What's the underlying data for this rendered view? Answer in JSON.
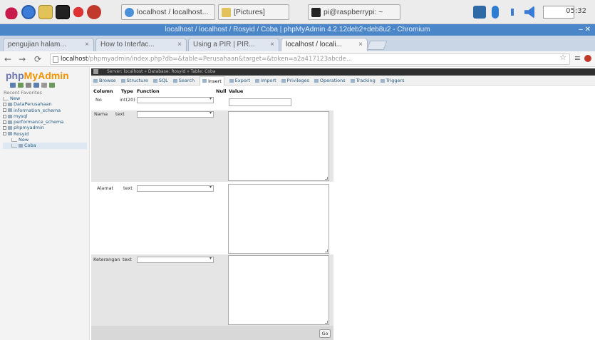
{
  "taskbar": {
    "tasks": [
      {
        "label": "localhost / localhost..."
      },
      {
        "label": "[Pictures]"
      },
      {
        "label": "pi@raspberrypi: ~"
      }
    ],
    "clock": "05:32"
  },
  "browser": {
    "window_title": "localhost / localhost / Rosyid / Coba | phpMyAdmin 4.2.12deb2+deb8u2 - Chromium",
    "tabs": [
      {
        "label": "pengujian halam..."
      },
      {
        "label": "How to Interfac..."
      },
      {
        "label": "Using a PIR | PIR..."
      },
      {
        "label": "localhost / locali..."
      }
    ],
    "address": {
      "host": "localhost",
      "rest": "/phpmyadmin/index.php?db=&table=Perusahaan&target=&token=a2a417123abcde..."
    }
  },
  "pma": {
    "logo_php": "php",
    "logo_my": "MyAdmin",
    "recent_label": "Recent  Favorites",
    "tree": [
      {
        "label": "New",
        "level": 1
      },
      {
        "label": "DataPerusahaan",
        "level": 0
      },
      {
        "label": "information_schema",
        "level": 0
      },
      {
        "label": "mysql",
        "level": 0
      },
      {
        "label": "performance_schema",
        "level": 0
      },
      {
        "label": "phpmyadmin",
        "level": 0
      },
      {
        "label": "Rosyid",
        "level": 0
      },
      {
        "label": "New",
        "level": 2
      },
      {
        "label": "Coba",
        "level": 2,
        "selected": true
      }
    ],
    "breadcrumb": "Server: localhost » Database: Rosyid » Table: Coba",
    "menu": [
      {
        "label": "Browse"
      },
      {
        "label": "Structure"
      },
      {
        "label": "SQL"
      },
      {
        "label": "Search"
      },
      {
        "label": "Insert",
        "active": true
      },
      {
        "label": "Export"
      },
      {
        "label": "Import"
      },
      {
        "label": "Privileges"
      },
      {
        "label": "Operations"
      },
      {
        "label": "Tracking"
      },
      {
        "label": "Triggers"
      }
    ],
    "insert_form": {
      "headers": {
        "column": "Column",
        "type": "Type",
        "function": "Function",
        "null": "Null",
        "value": "Value"
      },
      "rows": [
        {
          "column": "No",
          "type": "int(20)"
        },
        {
          "column": "Nama",
          "type": "text"
        },
        {
          "column": "Alamat",
          "type": "text"
        },
        {
          "column": "Keterangan",
          "type": "text"
        }
      ],
      "go_label": "Go"
    }
  }
}
